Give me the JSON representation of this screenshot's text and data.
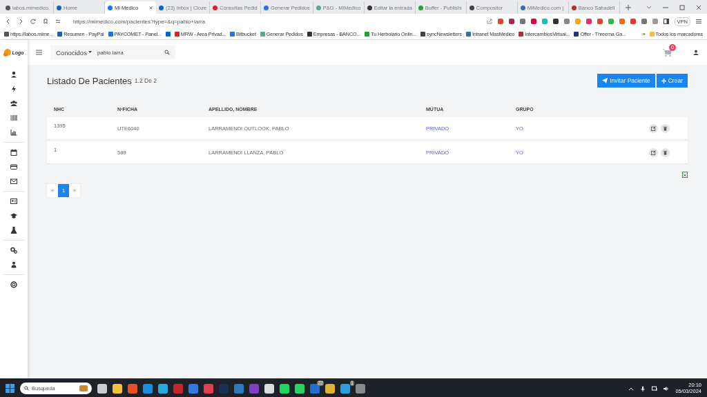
{
  "browser": {
    "tabs": [
      {
        "title": "labos.mimedico.",
        "selected": false
      },
      {
        "title": "Home",
        "selected": false
      },
      {
        "title": "Mi Medico",
        "selected": true
      },
      {
        "title": "(23) Inbox | Cloze",
        "selected": false
      },
      {
        "title": "Consultas Pedid",
        "selected": false
      },
      {
        "title": "Generar Pedidos",
        "selected": false
      },
      {
        "title": "P&G - MiMedico",
        "selected": false
      },
      {
        "title": "Editar la entrada",
        "selected": false
      },
      {
        "title": "Buffer - Publishi",
        "selected": false
      },
      {
        "title": "Compositor",
        "selected": false
      },
      {
        "title": "MiMedico.com |",
        "selected": false
      },
      {
        "title": "Banco Sabadell",
        "selected": false
      }
    ],
    "url": "https://mimedico.com/pacientes?type=&q=pablo+larra",
    "vpn_label": "VPN",
    "bookmarks": [
      {
        "kind": "link",
        "label": "https://labos.mime..."
      },
      {
        "kind": "link",
        "label": "Resumen - PayPal"
      },
      {
        "kind": "link",
        "label": "PAYCOMET - Panel..."
      },
      {
        "kind": "icon"
      },
      {
        "kind": "link",
        "label": "MRW - Area Privad..."
      },
      {
        "kind": "link",
        "label": "Bitbucket"
      },
      {
        "kind": "link",
        "label": "Generar Pedidos"
      },
      {
        "kind": "link",
        "label": "Empresas - BANCO..."
      },
      {
        "kind": "link",
        "label": "Tu Herbolario Onlin..."
      },
      {
        "kind": "link",
        "label": "syncNewsletters"
      },
      {
        "kind": "link",
        "label": "Intranet MasMedico"
      },
      {
        "kind": "link",
        "label": "IntercambiosVirtual..."
      },
      {
        "kind": "link",
        "label": "Offer - Threema Ga..."
      }
    ],
    "bookmarks_more": "»",
    "all_bookmarks": "Todos los marcadores"
  },
  "app": {
    "logo_text": "Logo",
    "filter": "Conocidos",
    "search_value": "pablo larra",
    "cart_count": "0",
    "title": "Listado De Pacientes",
    "range": "1.2 De 2",
    "buttons": [
      {
        "label": "Invitar Paciente",
        "kind": "invite"
      },
      {
        "label": "Crear",
        "kind": "create"
      }
    ],
    "table": {
      "columns": [
        "NHC",
        "NºFICHA",
        "APELLIDO, NOMBRE",
        "MÚTUA",
        "GRUPO"
      ],
      "rows": [
        {
          "nhc": "1395",
          "ficha": "UTE6040",
          "name": "LARRAMENDI OUTLOOK, PABLO",
          "mutua": "PRIVADO",
          "grupo": "YO"
        },
        {
          "nhc": "1",
          "ficha": "589",
          "name": "LARRAMENDI LLANZA, PABLO",
          "mutua": "PRIVADO",
          "grupo": "YO"
        }
      ]
    },
    "pagination": {
      "prev": "«",
      "pages": [
        {
          "label": "1",
          "selected": true
        }
      ],
      "next": "»"
    }
  },
  "taskbar": {
    "search_placeholder": "Búsqueda",
    "badges": [
      "22",
      "1"
    ],
    "time": "20:10",
    "date": "05/03/2024"
  }
}
